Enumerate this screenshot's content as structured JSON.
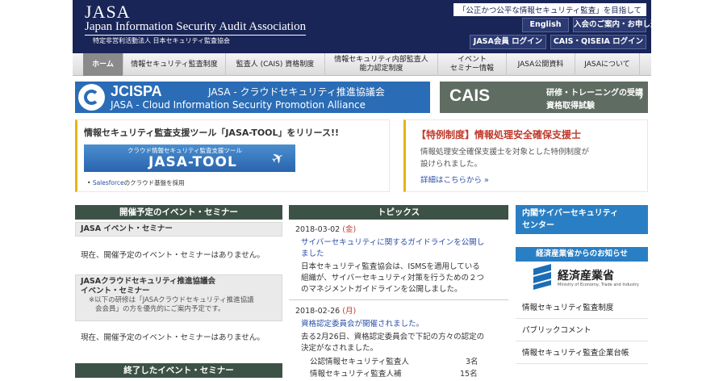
{
  "header": {
    "logo_line1": "JASA",
    "logo_line2": "Japan Information Security Audit Association",
    "logo_jp": "特定非営利活動法人 日本セキュリティ監査協会",
    "tagline": "「公正かつ公平な情報セキュリティ監査」を目指して",
    "btn_english": "English",
    "btn_join": "入会のご案内・お申し込み",
    "btn_member_login": "JASA会員 ログイン",
    "btn_cais_login": "CAIS・QISEIA ログイン"
  },
  "nav": [
    "ホーム",
    "情報セキュリティ監査制度",
    "監査人 (CAIS) 資格制度",
    "情報セキュリティ内部監査人\n能力認定制度",
    "イベント\nセミナー情報",
    "JASA公開資料",
    "JASAについて"
  ],
  "banners": {
    "cispa_logo": "JCISPA",
    "cispa_jp": "JASA - クラウドセキュリティ推進協議会",
    "cispa_en": "JASA - Cloud Information Security Promotion Alliance",
    "cais_logo": "CAIS",
    "cais_text1": "研修・トレーニングの受講",
    "cais_text2": "資格取得試験"
  },
  "feature_left": {
    "title": "情報セキュリティ監査支援ツール「JASA-TOOL」をリリース!!",
    "img_caption": "クラウド情報セキュリティ監査支援ツール",
    "img_title": "JASA-TOOL",
    "img_note_brand": "Salesforce",
    "img_note_rest": "のクラウド基盤を採用"
  },
  "feature_right": {
    "title": "【特例制度】情報処理安全確保支援士",
    "line1": "情報処理安全確保支援士を対象とした特例制度が",
    "line2": "設けられました。",
    "more": "詳細はこちらから »"
  },
  "events": {
    "header": "開催予定のイベント・セミナー",
    "jasa_sub": "JASA イベント・セミナー",
    "none1": "現在、開催予定のイベント・セミナーはありません。",
    "cloud_sub1": "JASAクラウドセキュリティ推進協議会",
    "cloud_sub2": "イベント・セミナー",
    "note1": "※以下の研修は「JASAクラウドセキュリティ推進協議",
    "note2": "会会員」の方を優先的にご案内予定です。",
    "none2": "現在、開催予定のイベント・セミナーはありません。",
    "past_header": "終了したイベント・セミナー"
  },
  "topics": {
    "header": "トピックス",
    "t1_date": "2018-03-02",
    "t1_day": "(金)",
    "t1_title1": "サイバーセキュリティに関するガイドラインを公開し",
    "t1_title2": "ました",
    "t1_body1": "日本セキュリティ監査協会は、ISMSを適用している",
    "t1_body2": "組織が、サイバーセキュリティ対策を行うための２つ",
    "t1_body3": "のマネジメントガイドラインを公開しました。",
    "t2_date": "2018-02-26",
    "t2_day": "(月)",
    "t2_title": "資格認定委員会が開催されました。",
    "t2_body1": "去る2月26日、資格認定委員会で下記の方々の認定の",
    "t2_body2": "決定がなされました。",
    "row1_label": "公認情報セキュリティ監査人",
    "row1_value": "3名",
    "row2_label": "情報セキュリティ監査人補",
    "row2_value": "15名"
  },
  "sidebar": {
    "cyber_header1": "内閣サイバーセキュリティ",
    "cyber_header2": "センター",
    "meti_header": "経済産業省からのお知らせ",
    "meti_logo_jp": "経済産業省",
    "meti_logo_en": "Ministry of Economy, Trade and Industry",
    "links": [
      "情報セキュリティ監査制度",
      "パブリックコメント",
      "情報セキュリティ監査企業台帳"
    ]
  },
  "colors": {
    "header_bg": "#1a2557",
    "nav_active": "#8a8a8a",
    "section_header": "#3d5246",
    "sidebar_blue": "#2a7fc4",
    "accent_red": "#c0392b",
    "accent_yellow": "#e6b600"
  }
}
